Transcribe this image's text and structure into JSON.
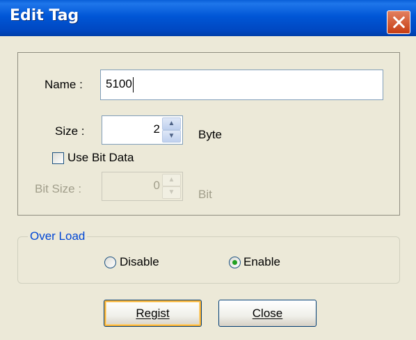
{
  "window": {
    "title": "Edit Tag"
  },
  "form": {
    "name_label": "Name :",
    "name_value": "5100",
    "size_label": "Size :",
    "size_value": "2",
    "size_unit": "Byte",
    "use_bit_label": "Use Bit Data",
    "use_bit_checked": false,
    "bit_size_label": "Bit Size :",
    "bit_size_value": "0",
    "bit_unit": "Bit"
  },
  "overload": {
    "title": "Over Load",
    "disable_label": "Disable",
    "enable_label": "Enable",
    "selected": "Enable"
  },
  "buttons": {
    "regist": "Regist",
    "close": "Close"
  },
  "colors": {
    "titlebar": "#0058e6",
    "close": "#d75a2c",
    "face": "#ece9d8",
    "groupbox_title": "#0046d5"
  }
}
